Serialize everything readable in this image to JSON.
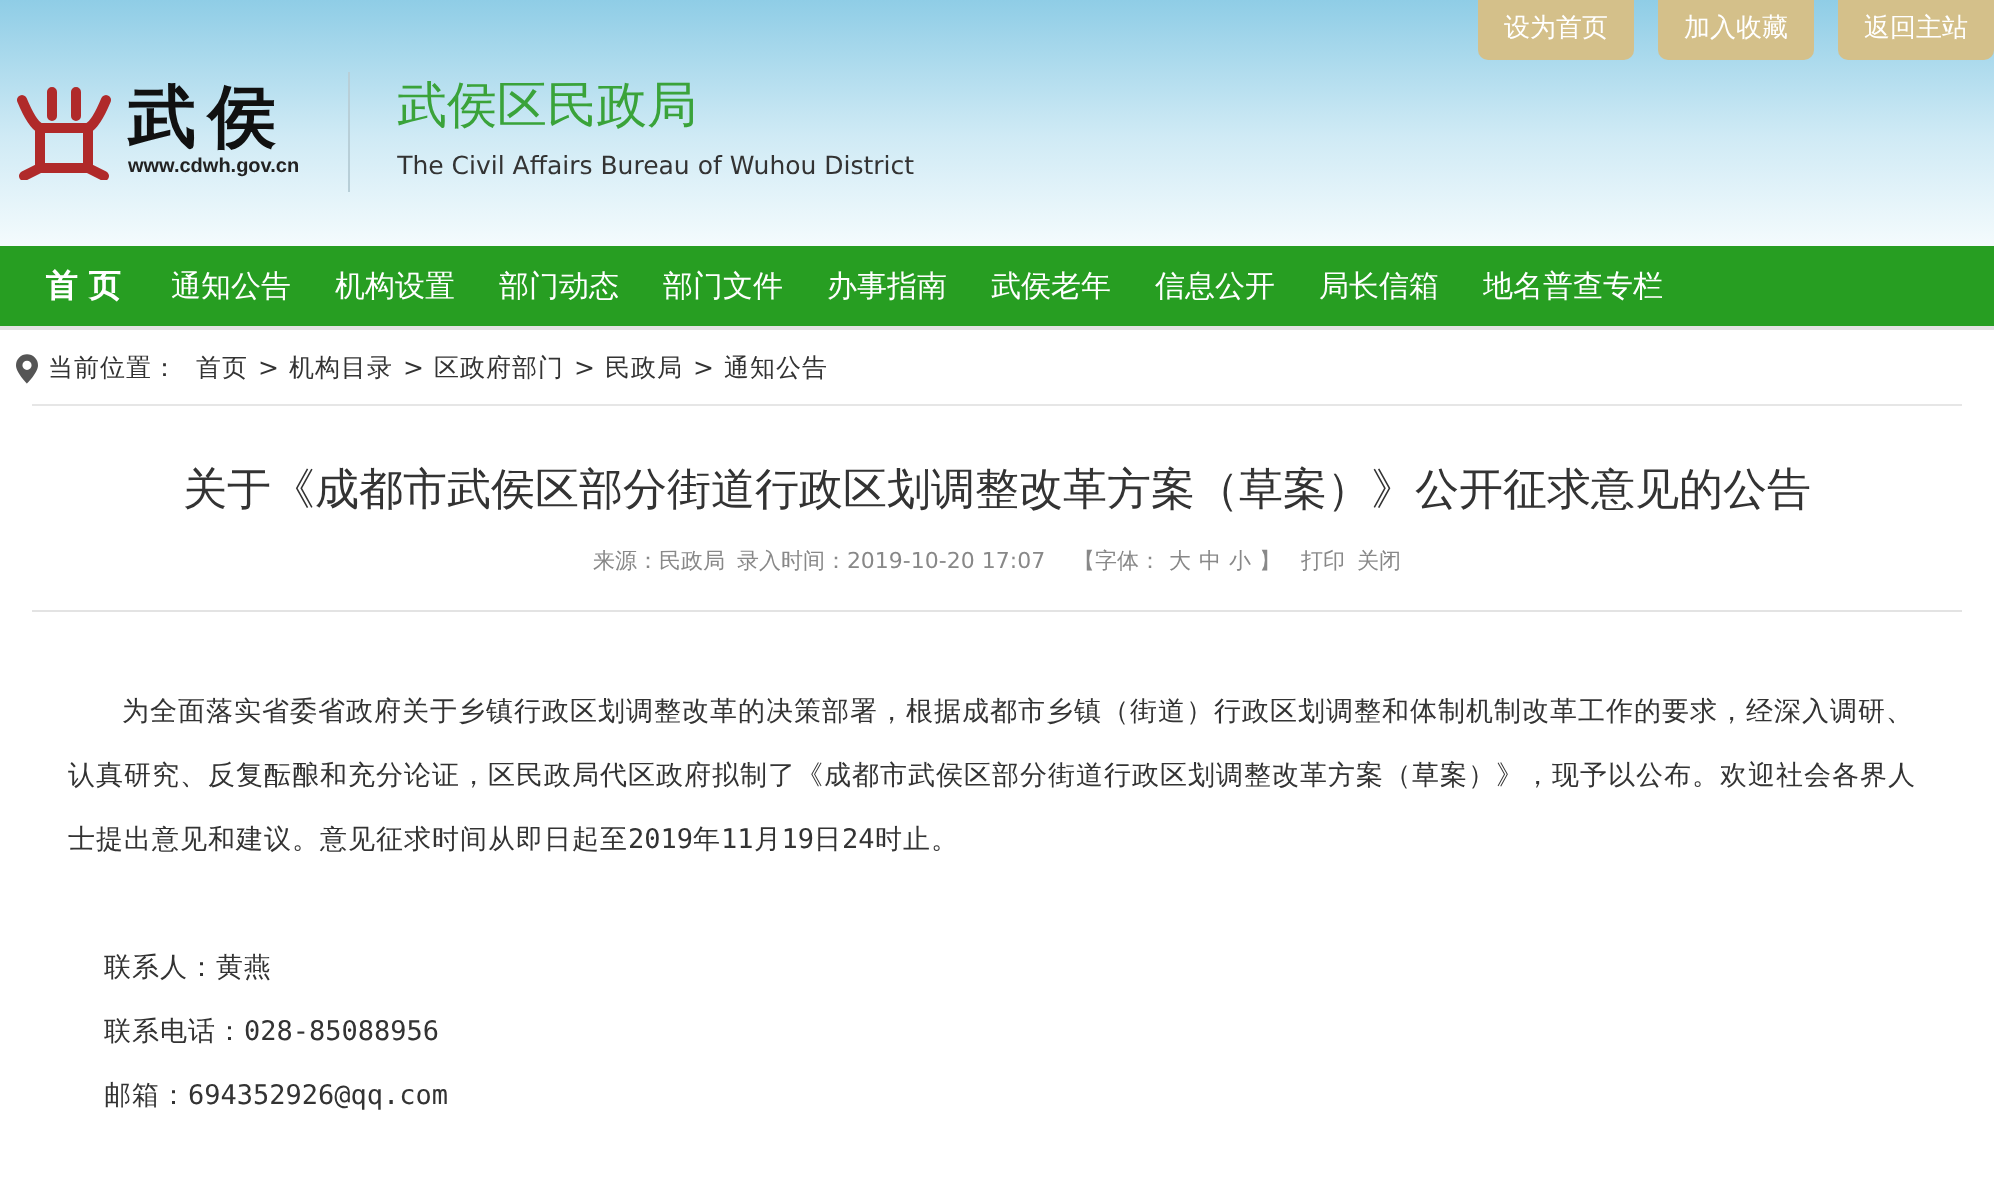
{
  "header": {
    "logo_chars": "武侯",
    "logo_url": "www.cdwh.gov.cn",
    "site_title": "武侯区民政局",
    "site_subtitle": "The Civil Affairs Bureau of Wuhou District",
    "top_links": [
      "设为首页",
      "加入收藏",
      "返回主站"
    ]
  },
  "nav": [
    {
      "label": "首 页",
      "selected": true
    },
    {
      "label": "通知公告",
      "selected": false
    },
    {
      "label": "机构设置",
      "selected": false
    },
    {
      "label": "部门动态",
      "selected": false
    },
    {
      "label": "部门文件",
      "selected": false
    },
    {
      "label": "办事指南",
      "selected": false
    },
    {
      "label": "武侯老年",
      "selected": false
    },
    {
      "label": "信息公开",
      "selected": false
    },
    {
      "label": "局长信箱",
      "selected": false
    },
    {
      "label": "地名普查专栏",
      "selected": false
    }
  ],
  "breadcrumb": {
    "label": "当前位置：",
    "items": [
      "首页",
      "机构目录",
      "区政府部门",
      "民政局",
      "通知公告"
    ],
    "separator": ">"
  },
  "article": {
    "title": "关于《成都市武侯区部分街道行政区划调整改革方案（草案）》公开征求意见的公告",
    "meta": {
      "source": "来源：民政局",
      "time": "录入时间：2019-10-20 17:07",
      "font_open": "【字体：",
      "font_sizes": [
        "大",
        "中",
        "小"
      ],
      "font_close": "】",
      "print": "打印",
      "close": "关闭"
    },
    "body": "为全面落实省委省政府关于乡镇行政区划调整改革的决策部署，根据成都市乡镇（街道）行政区划调整和体制机制改革工作的要求，经深入调研、认真研究、反复酝酿和充分论证，区民政局代区政府拟制了《成都市武侯区部分街道行政区划调整改革方案（草案）》，现予以公布。欢迎社会各界人士提出意见和建议。意见征求时间从即日起至2019年11月19日24时止。",
    "contacts": [
      "联系人：黄燕",
      "联系电话：028-85088956",
      "邮箱：694352926@qq.com"
    ]
  }
}
